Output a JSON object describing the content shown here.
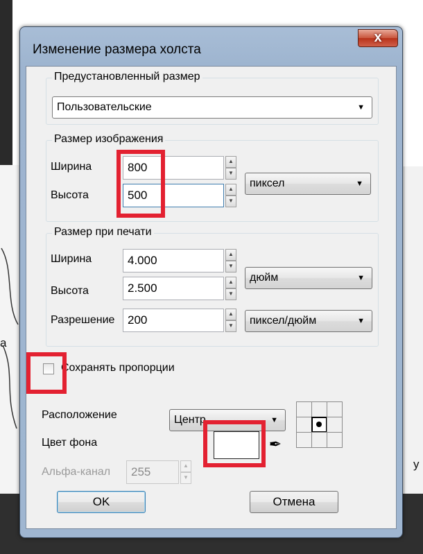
{
  "background": {
    "letter_a": "а",
    "letter_y": "у"
  },
  "dialog": {
    "title": "Изменение размера холста",
    "close_label": "x"
  },
  "preset": {
    "group_title": "Предустановленный размер",
    "selected": "Пользовательские"
  },
  "image_size": {
    "group_title": "Размер изображения",
    "width_label": "Ширина",
    "width_value": "800",
    "height_label": "Высота",
    "height_value": "500",
    "unit": "пиксел"
  },
  "print_size": {
    "group_title": "Размер при печати",
    "width_label": "Ширина",
    "width_value": "4.000",
    "height_label": "Высота",
    "height_value": "2.500",
    "unit": "дюйм",
    "resolution_label": "Разрешение",
    "resolution_value": "200",
    "resolution_unit": "пиксел/дюйм"
  },
  "keep_ratio": {
    "label": "Сохранять пропорции",
    "checked": false
  },
  "anchor": {
    "label": "Расположение",
    "selected": "Центр",
    "selected_cell": "center"
  },
  "background_color": {
    "label": "Цвет фона",
    "value": "#FFFFFF"
  },
  "alpha": {
    "label": "Альфа-канал",
    "value": "255",
    "enabled": false
  },
  "buttons": {
    "ok": "OK",
    "cancel": "Отмена"
  },
  "highlight_color": "#E32131"
}
